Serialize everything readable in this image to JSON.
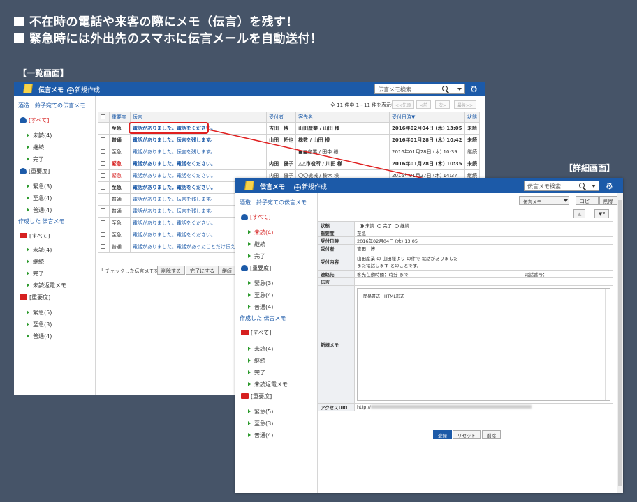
{
  "headlines": [
    "不在時の電話や来客の際にメモ（伝言）を残す！",
    "緊急時には外出先のスマホに伝言メールを自動送付！"
  ],
  "list_caption": "【一覧画面】",
  "detail_caption": "【詳細画面】",
  "app": {
    "name": "伝言メモ",
    "new_label": "新規作成",
    "search_placeholder": "伝言メモ検索",
    "gear_icon": "gear-icon"
  },
  "sidebar": {
    "received_title": "酒造　鈴子宛ての伝言メモ",
    "all_label": "[すべて]",
    "received_items": [
      "未読(4)",
      "継続",
      "完了"
    ],
    "priority_label": "[重要度]",
    "priority_items": [
      "緊急(3)",
      "至急(4)",
      "普通(4)"
    ],
    "created_title": "作成した 伝言メモ",
    "created_items": [
      "未読(4)",
      "継続",
      "完了",
      "未読返電メモ"
    ],
    "created_priority_items": [
      "緊急(5)",
      "至急(3)",
      "普通(4)"
    ]
  },
  "list": {
    "pager_text": "全 11 件中 1 - 11 件を表示中",
    "pager_buttons": [
      "<<先頭",
      "<前",
      "次>",
      "最後>>"
    ],
    "columns": [
      "重要度",
      "伝言",
      "受付者",
      "客先名",
      "受付日時▼",
      "状態"
    ],
    "rows": [
      {
        "priority": "至急",
        "subject": "電話がありました。電話をください。",
        "receiver": "吉田　博",
        "customer": "山田産業 / 山田 様",
        "date": "2016年02月04日 (木) 13:05",
        "status": "未読",
        "bold": true,
        "red": false
      },
      {
        "priority": "普通",
        "subject": "電話がありました。伝言を残します。",
        "receiver": "山田　拓也",
        "customer": "株数 / 山田 様",
        "date": "2016年01月28日 (木) 10:42",
        "status": "未読",
        "bold": true,
        "red": false
      },
      {
        "priority": "至急",
        "subject": "電話がありました。伝言を残します。",
        "receiver": "",
        "customer": "■■産業 / 田中 様",
        "date": "2016年01月28日 (木) 10:39",
        "status": "継続",
        "bold": false,
        "red": false
      },
      {
        "priority": "緊急",
        "subject": "電話がありました。電話をください。",
        "receiver": "内田　優子",
        "customer": "△△市役所 / 川田 様",
        "date": "2016年01月28日 (木) 10:35",
        "status": "未読",
        "bold": true,
        "red": true
      },
      {
        "priority": "緊急",
        "subject": "電話がありました。電話をください。",
        "receiver": "内田　優子",
        "customer": "〇〇機械 / 鈴木 様",
        "date": "2016年01月27日 (木) 14:37",
        "status": "継続",
        "bold": false,
        "red": true
      },
      {
        "priority": "至急",
        "subject": "電話がありました。電話をください。",
        "receiver": "",
        "customer": "",
        "date": "",
        "status": "",
        "bold": true,
        "red": false
      },
      {
        "priority": "普通",
        "subject": "電話がありました。伝言を残します。",
        "receiver": "",
        "customer": "",
        "date": "",
        "status": "",
        "bold": false,
        "red": false
      },
      {
        "priority": "普通",
        "subject": "電話がありました。伝言を残します。",
        "receiver": "",
        "customer": "",
        "date": "",
        "status": "",
        "bold": false,
        "red": false
      },
      {
        "priority": "至急",
        "subject": "電話がありました。電話をください。",
        "receiver": "",
        "customer": "",
        "date": "",
        "status": "",
        "bold": false,
        "red": false
      },
      {
        "priority": "至急",
        "subject": "電話がありました。電話をください。",
        "receiver": "",
        "customer": "",
        "date": "",
        "status": "",
        "bold": false,
        "red": false
      },
      {
        "priority": "普通",
        "subject": "電話がありました。電話があったことだけ伝えてくだ",
        "receiver": "",
        "customer": "",
        "date": "",
        "status": "",
        "bold": false,
        "red": false
      }
    ],
    "bulk_label": "チェックした伝言メモを",
    "bulk_buttons": [
      "削除する",
      "完了にする",
      "継続"
    ]
  },
  "detail": {
    "select_value": "伝言メモ",
    "copy_label": "コピー",
    "delete_label": "削除",
    "nav_prev": "▲",
    "nav_next": "▼F",
    "fields": {
      "status_label": "状態",
      "status_options": [
        "未読",
        "完了",
        "継続"
      ],
      "priority_label": "重要度",
      "priority_value": "至急",
      "date_label": "受付日時",
      "date_value": "2016年02月04日 (木) 13:05",
      "receiver_label": "受付者",
      "receiver_value": "吉田　博",
      "content_label": "受付内容",
      "content_value_1": "山田産業 の 山田様より の件で 電話がありました",
      "content_value_2": "また電話します とのことです。",
      "contact_label": "連絡先",
      "contact_value": "客先在動時間：時分 まで",
      "phone_label": "電話番号：",
      "message_label": "伝言",
      "new_memo_label": "新規メモ",
      "editor_tools": "簡易書式　HTML形式",
      "access_label": "アクセスURL",
      "access_prefix": "http://"
    },
    "buttons": [
      "登録",
      "リセット",
      "削除"
    ]
  }
}
